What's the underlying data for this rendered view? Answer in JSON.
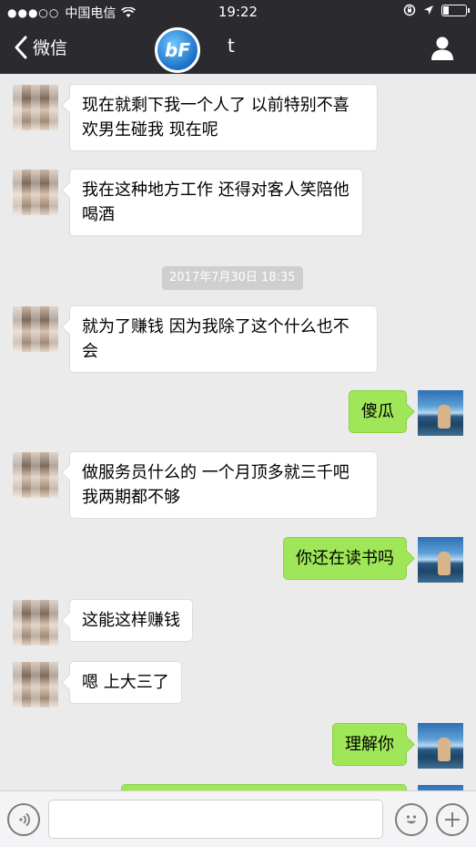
{
  "status_bar": {
    "signal": "●●●○○",
    "carrier": "中国电信",
    "time": "19:22"
  },
  "nav": {
    "back_label": "微信",
    "logo_text": "bF",
    "title": "t"
  },
  "chat": {
    "timestamp": "2017年7月30日 18:35",
    "messages": [
      {
        "side": "left",
        "text": "现在就剩下我一个人了 以前特别不喜欢男生碰我 现在呢"
      },
      {
        "side": "left",
        "text": "我在这种地方工作 还得对客人笑陪他喝酒"
      },
      {
        "side": "left",
        "text": "就为了赚钱 因为我除了这个什么也不会"
      },
      {
        "side": "right",
        "text": "傻瓜"
      },
      {
        "side": "left",
        "text": "做服务员什么的 一个月顶多就三千吧 我两期都不够"
      },
      {
        "side": "right",
        "text": "你还在读书吗"
      },
      {
        "side": "left",
        "text": "这能这样赚钱"
      },
      {
        "side": "left",
        "text": "嗯 上大三了"
      },
      {
        "side": "right",
        "text": "理解你"
      },
      {
        "side": "right",
        "text": ""
      }
    ]
  },
  "input": {
    "value": "",
    "placeholder": ""
  },
  "icons": {
    "wifi": "wifi-icon",
    "lock_rotation": "rotation-lock-icon",
    "location": "location-arrow-icon",
    "battery": "battery-icon",
    "back": "chevron-left-icon",
    "profile": "person-icon",
    "voice": "voice-icon",
    "emoji": "emoji-icon",
    "plus": "plus-icon"
  },
  "colors": {
    "nav_bg": "#2b2b2f",
    "chat_bg": "#ebebeb",
    "bubble_self": "#9fe658",
    "bubble_other": "#ffffff"
  }
}
